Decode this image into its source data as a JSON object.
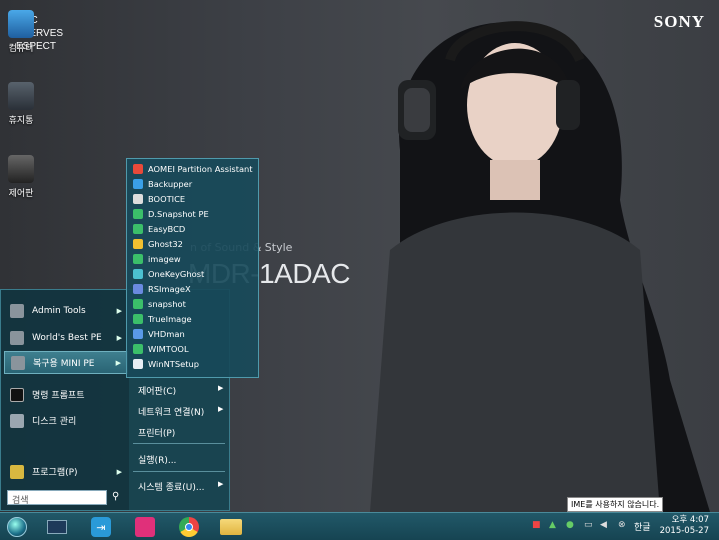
{
  "wallpaper": {
    "brand": "SONY",
    "tagline": "n of Sound & Style",
    "model": "MDR-1ADAC",
    "corner_lines": [
      "JSIC",
      "ESERVES",
      "ESPECT"
    ]
  },
  "desktop": {
    "icons": [
      {
        "label": "컴퓨터",
        "icon": "computer-icon"
      },
      {
        "label": "휴지통",
        "icon": "recycle-bin-icon"
      },
      {
        "label": "제어판",
        "icon": "control-panel-icon"
      }
    ]
  },
  "start_menu": {
    "left_items": [
      {
        "label": "Admin Tools",
        "has_submenu": true
      },
      {
        "label": "World's Best PE",
        "has_submenu": true
      },
      {
        "label": "복구용 MINI PE",
        "has_submenu": true,
        "selected": true
      },
      {
        "label": "명령 프롬프트",
        "has_submenu": false
      },
      {
        "label": "디스크 관리",
        "has_submenu": false
      },
      {
        "label": "프로그램(P)",
        "has_submenu": true
      }
    ],
    "right_items": [
      {
        "label": "제어판(C)",
        "has_submenu": true
      },
      {
        "label": "네트워크 연결(N)",
        "has_submenu": true
      },
      {
        "label": "프린터(P)",
        "has_submenu": false
      },
      {
        "label": "실행(R)...",
        "has_submenu": false
      },
      {
        "label": "시스템 종료(U)...",
        "has_submenu": true
      }
    ],
    "search_placeholder": "검색",
    "submenu_items": [
      "AOMEI Partition Assistant",
      "Backupper",
      "BOOTICE",
      "D.Snapshot PE",
      "EasyBCD",
      "Ghost32",
      "imagew",
      "OneKeyGhost",
      "RSImageX",
      "snapshot",
      "TrueImage",
      "VHDman",
      "WIMTOOL",
      "WinNTSetup"
    ]
  },
  "taskbar": {
    "apps": [
      "start-orb-icon",
      "explorer-window-icon",
      "logoff-icon",
      "presentation-icon",
      "chrome-icon",
      "folder-icon"
    ],
    "tray_language": "한글",
    "clock_time": "오후 4:07",
    "clock_date": "2015-05-27",
    "tooltip": "IME를 사용하지 않습니다."
  }
}
